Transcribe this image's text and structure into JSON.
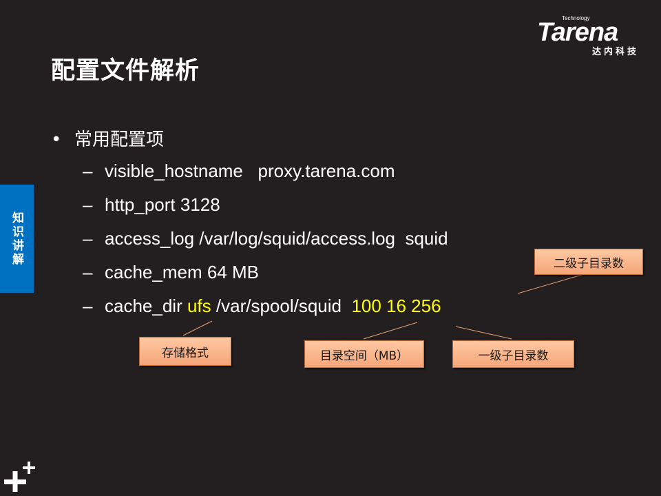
{
  "title": "配置文件解析",
  "logo": {
    "technology": "Technology",
    "wordmark": "Tarena",
    "chinese": "达内科技"
  },
  "side_tab": {
    "label": "知识讲解"
  },
  "bullet": {
    "label": "常用配置项",
    "items": [
      {
        "parts": [
          "visible_hostname   proxy.tarena.com"
        ]
      },
      {
        "parts": [
          "http_port 3128"
        ]
      },
      {
        "parts": [
          "access_log /var/log/squid/access.log  squid"
        ]
      },
      {
        "parts": [
          "cache_mem 64 MB"
        ]
      },
      {
        "prefix": "cache_dir ",
        "ufs": "ufs",
        "path": " /var/spool/squid  ",
        "nums": "100 16 256"
      }
    ]
  },
  "callouts": {
    "storage_format": "存储格式",
    "dir_space": "目录空间（MB）",
    "level1_dirs": "一级子目录数",
    "level2_dirs": "二级子目录数"
  },
  "colors": {
    "background": "#231f20",
    "highlight": "#ffff00",
    "side_tab": "#0070c0",
    "callout_fill": "#f5a678",
    "leader_line": "#e8a070"
  },
  "icons": {
    "logo": "tarena-logo",
    "corner": "plus-plus-icon"
  }
}
